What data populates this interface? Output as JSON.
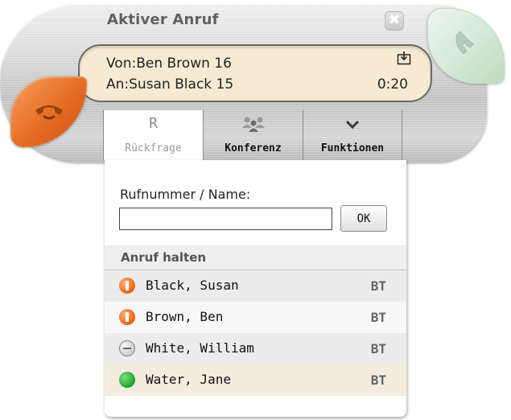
{
  "window": {
    "title": "Aktiver Anruf",
    "close_icon": "close-icon"
  },
  "call": {
    "from": "Von:Ben Brown 16",
    "to": "An:Susan Black 15",
    "duration": "0:20"
  },
  "tabs": [
    {
      "label": "Rückfrage",
      "icon": "R",
      "active": true
    },
    {
      "label": "Konferenz",
      "icon": "conference-icon",
      "active": false
    },
    {
      "label": "Funktionen",
      "icon": "chevron-down-icon",
      "active": false
    }
  ],
  "panel": {
    "search_label": "Rufnummer / Name:",
    "search_value": "",
    "ok_label": "OK",
    "section_title": "Anruf halten",
    "contacts": [
      {
        "name": "Black, Susan",
        "tag": "BT",
        "status": "busy"
      },
      {
        "name": "Brown, Ben",
        "tag": "BT",
        "status": "busy"
      },
      {
        "name": "White, William",
        "tag": "BT",
        "status": "away"
      },
      {
        "name": "Water, Jane",
        "tag": "BT",
        "status": "available"
      }
    ]
  },
  "colors": {
    "hangup": "#e56b21",
    "answer": "#d2e9d5",
    "info_bg": "#f7ead3",
    "row_alt": "#ececec",
    "row_selected": "#f4ecdf",
    "status_busy": "#e8620f",
    "status_available": "#1aa12c"
  }
}
